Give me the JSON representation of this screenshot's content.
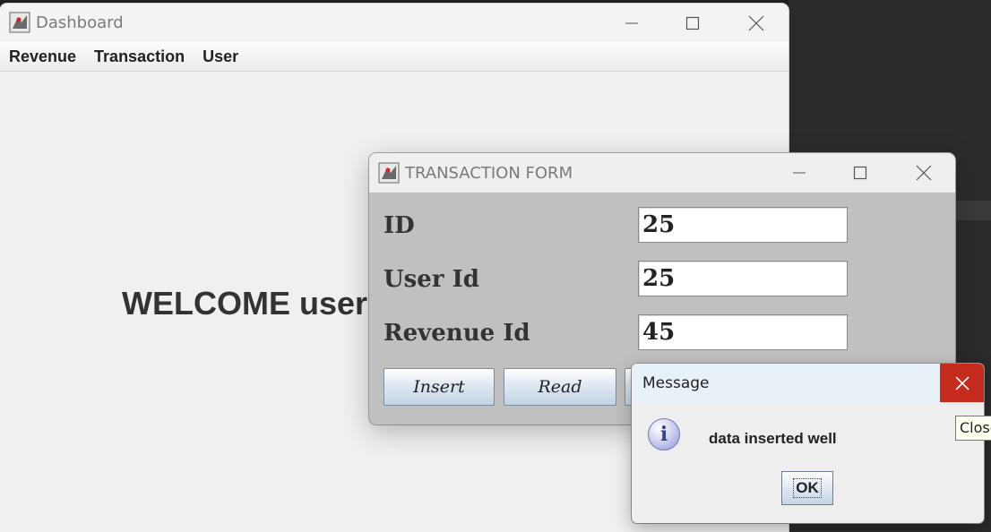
{
  "dashboard": {
    "title": "Dashboard",
    "menu": [
      "Revenue",
      "Transaction",
      "User"
    ],
    "welcome": "WELCOME user("
  },
  "transaction_form": {
    "title": "TRANSACTION FORM",
    "fields": [
      {
        "label": "ID",
        "value": "25"
      },
      {
        "label": "User Id",
        "value": "25"
      },
      {
        "label": "Revenue Id",
        "value": "45"
      }
    ],
    "buttons": [
      "Insert",
      "Read"
    ]
  },
  "message_dialog": {
    "title": "Message",
    "text": "data inserted well",
    "ok_label": "OK",
    "close_tooltip": "Close"
  },
  "colors": {
    "close_hover": "#c42b1c",
    "form_background": "#c0c0c0",
    "dashboard_background": "#f0f0f0"
  },
  "icons": [
    "java-app-icon",
    "minimize-icon",
    "maximize-icon",
    "close-icon",
    "info-icon"
  ]
}
